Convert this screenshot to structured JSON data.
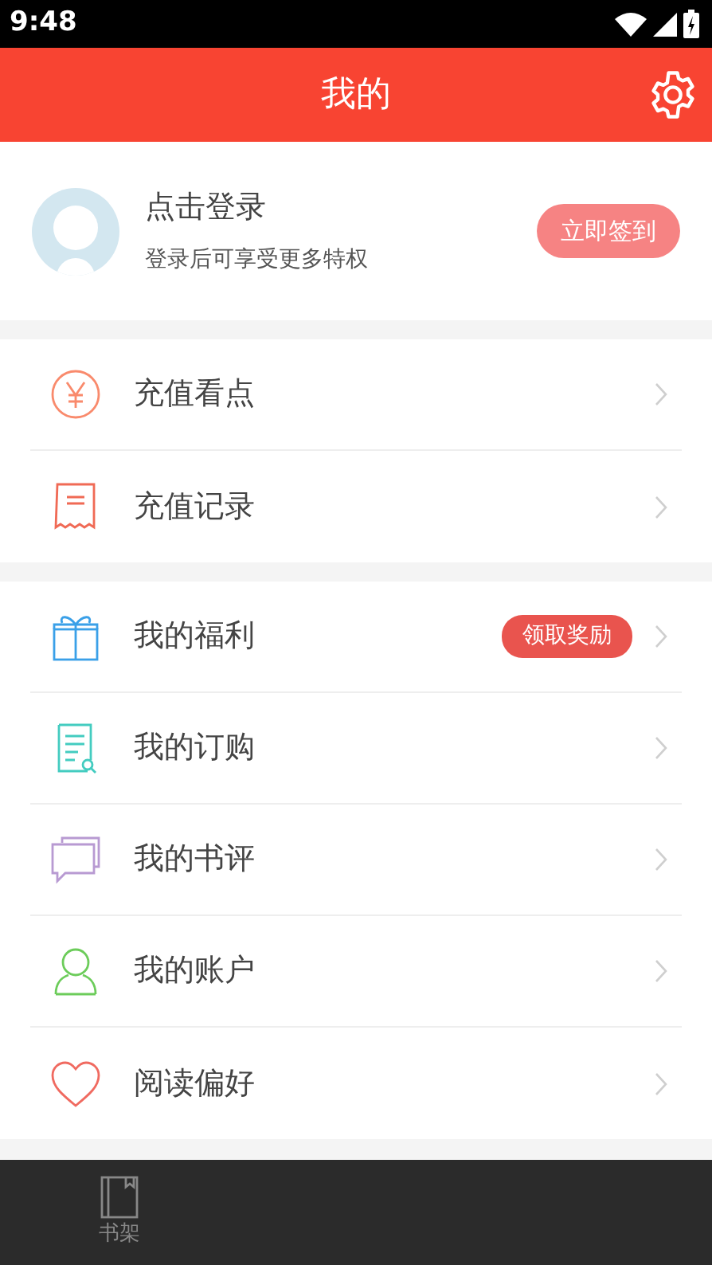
{
  "status_bar": {
    "time": "9:48"
  },
  "header": {
    "title": "我的"
  },
  "profile": {
    "name": "点击登录",
    "subtitle": "登录后可享受更多特权",
    "button": "立即签到"
  },
  "menu_groups": [
    {
      "items": [
        {
          "kind": "yuan",
          "label": "充值看点"
        },
        {
          "kind": "receipt",
          "label": "充值记录"
        }
      ]
    },
    {
      "items": [
        {
          "kind": "gift",
          "label": "我的福利",
          "badge": "领取奖励"
        },
        {
          "kind": "order",
          "label": "我的订购"
        },
        {
          "kind": "review",
          "label": "我的书评"
        },
        {
          "kind": "account",
          "label": "我的账户"
        },
        {
          "kind": "heart",
          "label": "阅读偏好"
        }
      ]
    }
  ],
  "bottom_nav": [
    {
      "label": "书架",
      "selected": false
    }
  ]
}
